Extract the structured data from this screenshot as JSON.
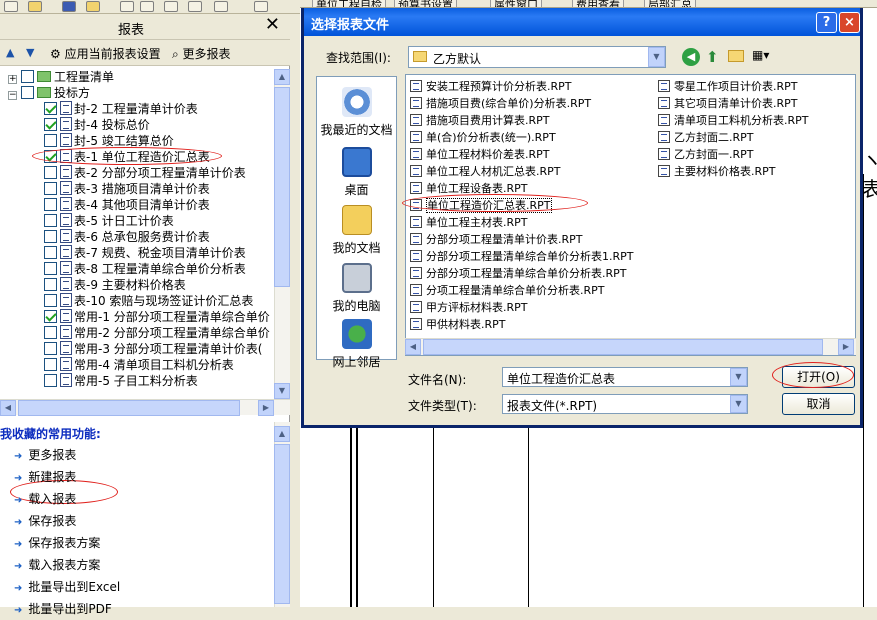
{
  "right_doc": {
    "partial_glyph": "ヽ, 表"
  },
  "app_tabs": [
    "单位工程自检",
    "预算书设置",
    "属性窗口",
    "费用查看",
    "局部汇总"
  ],
  "left_panel": {
    "title": "报表",
    "tools": {
      "apply": "应用当前报表设置",
      "more": "更多报表"
    },
    "tree": [
      {
        "label": "工程量清单",
        "level": 0,
        "expander": "+",
        "checked": false,
        "kind": "folder"
      },
      {
        "label": "投标方",
        "level": 0,
        "expander": "−",
        "checked": false,
        "kind": "folder"
      },
      {
        "label": "封-2 工程量清单计价表",
        "level": 1,
        "checked": true
      },
      {
        "label": "封-4 投标总价",
        "level": 1,
        "checked": true
      },
      {
        "label": "封-5 竣工结算总价",
        "level": 1,
        "checked": false
      },
      {
        "label": "表-1 单位工程造价汇总表",
        "level": 1,
        "checked": true
      },
      {
        "label": "表-2 分部分项工程量清单计价表",
        "level": 1,
        "checked": false
      },
      {
        "label": "表-3 措施项目清单计价表",
        "level": 1,
        "checked": false
      },
      {
        "label": "表-4 其他项目清单计价表",
        "level": 1,
        "checked": false
      },
      {
        "label": "表-5 计日工计价表",
        "level": 1,
        "checked": false
      },
      {
        "label": "表-6 总承包服务费计价表",
        "level": 1,
        "checked": false
      },
      {
        "label": "表-7 规费、税金项目清单计价表",
        "level": 1,
        "checked": false
      },
      {
        "label": "表-8 工程量清单综合单价分析表",
        "level": 1,
        "checked": false
      },
      {
        "label": "表-9 主要材料价格表",
        "level": 1,
        "checked": false
      },
      {
        "label": "表-10 索赔与现场签证计价汇总表",
        "level": 1,
        "checked": false
      },
      {
        "label": "常用-1 分部分项工程量清单综合单价",
        "level": 1,
        "checked": true
      },
      {
        "label": "常用-2 分部分项工程量清单综合单价",
        "level": 1,
        "checked": false
      },
      {
        "label": "常用-3 分部分项工程量清单计价表(",
        "level": 1,
        "checked": false
      },
      {
        "label": "常用-4 清单项目工料机分析表",
        "level": 1,
        "checked": false
      },
      {
        "label": "常用-5 子目工料分析表",
        "level": 1,
        "checked": false
      }
    ],
    "favorites_title": "我收藏的常用功能:",
    "favorites": [
      "更多报表",
      "新建报表",
      "载入报表",
      "保存报表",
      "保存报表方案",
      "载入报表方案",
      "批量导出到Excel",
      "批量导出到PDF"
    ]
  },
  "dialog": {
    "title": "选择报表文件",
    "help_btn": "?",
    "close_btn": "×",
    "lookin_label": "查找范围(I):",
    "lookin_value": "乙方默认",
    "places": [
      "我最近的文档",
      "桌面",
      "我的文档",
      "我的电脑",
      "网上邻居"
    ],
    "files_col1": [
      "安装工程预算计价分析表.RPT",
      "措施项目费(综合单价)分析表.RPT",
      "措施项目费用计算表.RPT",
      "单(合)价分析表(统一).RPT",
      "单位工程材料价差表.RPT",
      "单位工程人材机汇总表.RPT",
      "单位工程设备表.RPT",
      "单位工程造价汇总表.RPT",
      "单位工程主材表.RPT",
      "分部分项工程量清单计价表.RPT",
      "分部分项工程量清单综合单价分析表1.RPT",
      "分部分项工程量清单综合单价分析表.RPT",
      "分项工程量清单综合单价分析表.RPT",
      "甲方评标材料表.RPT",
      "甲供材料表.RPT"
    ],
    "files_col2": [
      "零星工作项目计价表.RPT",
      "其它项目清单计价表.RPT",
      "清单项目工料机分析表.RPT",
      "乙方封面二.RPT",
      "乙方封面一.RPT",
      "主要材料价格表.RPT"
    ],
    "selected_file": "单位工程造价汇总表.RPT",
    "filename_label": "文件名(N):",
    "filename_value": "单位工程造价汇总表",
    "filetype_label": "文件类型(T):",
    "filetype_value": "报表文件(*.RPT)",
    "open_btn": "打开(O)",
    "cancel_btn": "取消"
  }
}
